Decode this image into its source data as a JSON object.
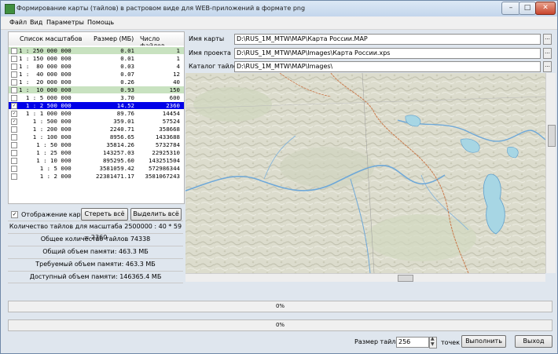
{
  "window": {
    "title": "Формирование карты (тайлов) в растровом виде для WEB-приложений в формате png"
  },
  "menu": [
    "Файл",
    "Вид",
    "Параметры",
    "Помощь"
  ],
  "scales_table": {
    "headers": [
      "Список масштабов",
      "Размер (МБ)",
      "Число файлов"
    ],
    "rows": [
      {
        "checked": false,
        "scale": "1 : 250 000 000",
        "mb": "0.01",
        "files": "1",
        "highlight": "green"
      },
      {
        "checked": false,
        "scale": "1 : 150 000 000",
        "mb": "0.01",
        "files": "1",
        "highlight": ""
      },
      {
        "checked": false,
        "scale": "1 :  80 000 000",
        "mb": "0.03",
        "files": "4",
        "highlight": ""
      },
      {
        "checked": false,
        "scale": "1 :  40 000 000",
        "mb": "0.07",
        "files": "12",
        "highlight": ""
      },
      {
        "checked": false,
        "scale": "1 :  20 000 000",
        "mb": "0.26",
        "files": "40",
        "highlight": ""
      },
      {
        "checked": false,
        "scale": "1 :  10 000 000",
        "mb": "0.93",
        "files": "150",
        "highlight": "green"
      },
      {
        "checked": false,
        "scale": "  1 : 5 000 000",
        "mb": "3.70",
        "files": "600",
        "highlight": ""
      },
      {
        "checked": true,
        "scale": "  1 : 2 500 000",
        "mb": "14.52",
        "files": "2360",
        "highlight": "selected"
      },
      {
        "checked": true,
        "scale": "  1 : 1 000 000",
        "mb": "89.76",
        "files": "14454",
        "highlight": ""
      },
      {
        "checked": true,
        "scale": "    1 : 500 000",
        "mb": "359.01",
        "files": "57524",
        "highlight": ""
      },
      {
        "checked": false,
        "scale": "    1 : 200 000",
        "mb": "2240.71",
        "files": "358668",
        "highlight": ""
      },
      {
        "checked": false,
        "scale": "    1 : 100 000",
        "mb": "8956.65",
        "files": "1433688",
        "highlight": ""
      },
      {
        "checked": false,
        "scale": "     1 : 50 000",
        "mb": "35814.26",
        "files": "5732784",
        "highlight": ""
      },
      {
        "checked": false,
        "scale": "     1 : 25 000",
        "mb": "143257.03",
        "files": "22925310",
        "highlight": ""
      },
      {
        "checked": false,
        "scale": "     1 : 10 000",
        "mb": "895295.60",
        "files": "143251504",
        "highlight": ""
      },
      {
        "checked": false,
        "scale": "      1 : 5 000",
        "mb": "3581059.42",
        "files": "572986344",
        "highlight": ""
      },
      {
        "checked": false,
        "scale": "      1 : 2 000",
        "mb": "22381471.17",
        "files": "3581067243",
        "highlight": ""
      }
    ]
  },
  "controls": {
    "show_map_label": "Отображение карты",
    "show_map_checked": true,
    "clear_all": "Стереть всё",
    "select_all": "Выделить всё"
  },
  "info": {
    "tiles_for_scale": "Количество тайлов для масштаба 2500000 : 40 * 59 = 2360",
    "total_tiles": "Общее количество тайлов 74338",
    "total_memory": "Общий объем памяти: 463.3 МБ",
    "required_memory": "Требуемый объем памяти: 463.3 МБ",
    "available_memory": "Доступный объем памяти: 146365.4 МБ"
  },
  "paths": {
    "map_label": "Имя карты",
    "map_value": "D:\\RUS_1M_MTW\\MAP\\Карта России.MAP",
    "project_label": "Имя проекта",
    "project_value": "D:\\RUS_1M_MTW\\MAP\\Images\\Карта России.xps",
    "catalog_label": "Каталог тайлов",
    "catalog_value": "D:\\RUS_1M_MTW\\MAP\\Images\\",
    "browse": "..."
  },
  "progress": {
    "bar1": "0%",
    "bar2": "0%",
    "value1": 0,
    "value2": 0
  },
  "footer": {
    "tile_size_label": "Размер тайла",
    "tile_size_value": "256",
    "points_label": "точек",
    "run": "Выполнить",
    "exit": "Выход"
  },
  "colors": {
    "selected_row": "#0000e8",
    "highlight_row": "#c8e2c0",
    "map_land": "#dcdccd",
    "water": "#a7d6e4",
    "border_line": "#c8784a"
  },
  "icons": [
    "app-icon",
    "minimize-icon",
    "maximize-icon",
    "close-icon",
    "checkbox-icon",
    "spin-up-icon",
    "spin-down-icon",
    "scroll-arrow-icon"
  ]
}
